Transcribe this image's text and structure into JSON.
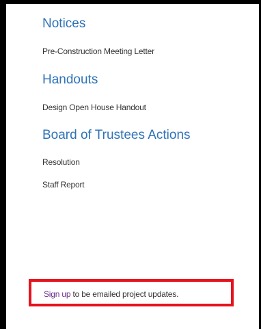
{
  "sections": [
    {
      "heading": "Notices",
      "links": [
        "Pre-Construction Meeting Letter"
      ]
    },
    {
      "heading": "Handouts",
      "links": [
        "Design Open House Handout"
      ]
    },
    {
      "heading": "Board of Trustees Actions",
      "links": [
        "Resolution",
        "Staff Report"
      ]
    }
  ],
  "signup": {
    "link_label": "Sign up",
    "text": " to be emailed project updates.",
    "highlight_color": "#e8121c"
  },
  "colors": {
    "heading": "#2f73b7",
    "link_visited": "#6a2c8e",
    "body_text": "#333333",
    "frame": "#000000"
  }
}
